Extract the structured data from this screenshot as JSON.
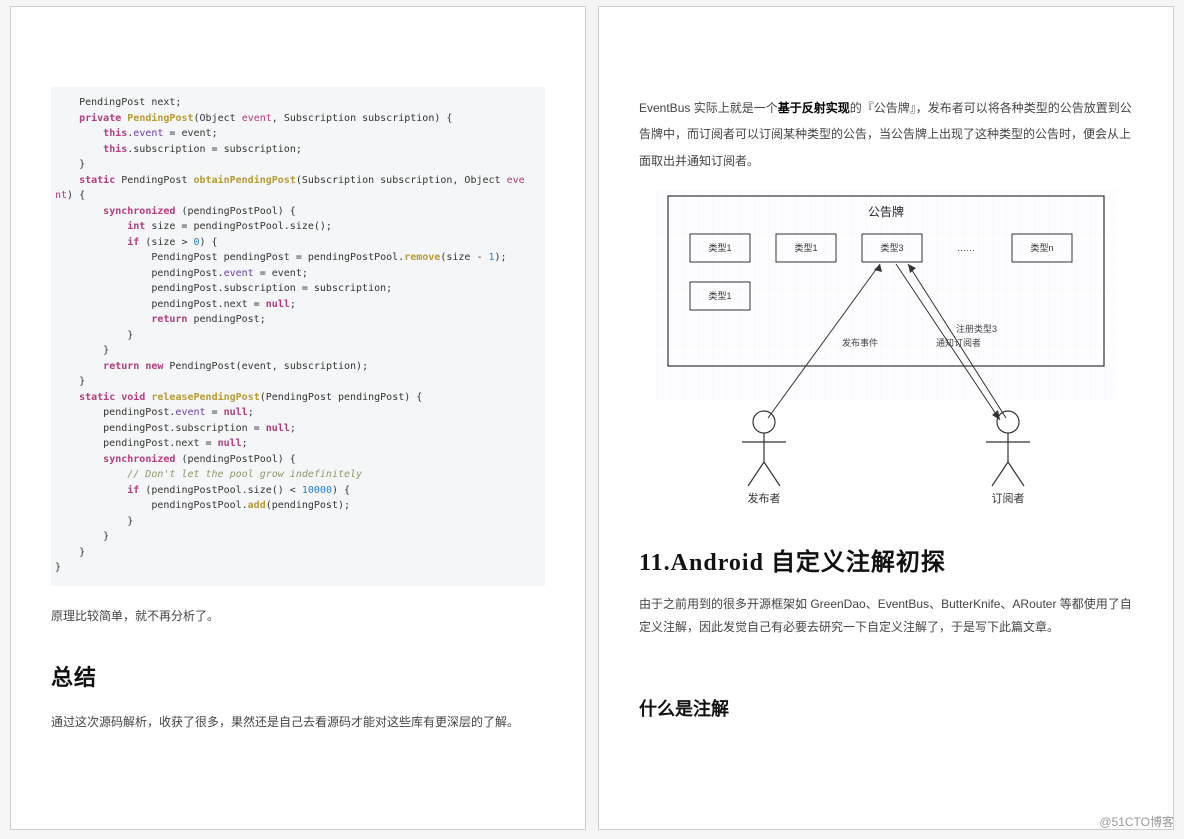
{
  "left": {
    "code_tokens": "CODE_RENDERED_DIRECTLY",
    "code_lines_plain": [
      "    PendingPost next;",
      "    private PendingPost(Object event, Subscription subscription) {",
      "        this.event = event;",
      "        this.subscription = subscription;",
      "    }",
      "    static PendingPost obtainPendingPost(Subscription subscription, Object eve",
      "nt) {",
      "        synchronized (pendingPostPool) {",
      "            int size = pendingPostPool.size();",
      "            if (size > 0) {",
      "                PendingPost pendingPost = pendingPostPool.remove(size - 1);",
      "                pendingPost.event = event;",
      "                pendingPost.subscription = subscription;",
      "                pendingPost.next = null;",
      "                return pendingPost;",
      "            }",
      "        }",
      "        return new PendingPost(event, subscription);",
      "    }",
      "    static void releasePendingPost(PendingPost pendingPost) {",
      "        pendingPost.event = null;",
      "        pendingPost.subscription = null;",
      "        pendingPost.next = null;",
      "        synchronized (pendingPostPool) {",
      "            // Don't let the pool grow indefinitely",
      "            if (pendingPostPool.size() < 10000) {",
      "                pendingPostPool.add(pendingPost);",
      "            }",
      "        }",
      "    }",
      "}"
    ],
    "after_code": "原理比较简单，就不再分析了。",
    "summary_title": "总结",
    "summary_body": "通过这次源码解析，收获了很多，果然还是自己去看源码才能对这些库有更深层的了解。"
  },
  "right": {
    "intro_pre": "EventBus  实际上就是一个",
    "intro_bold": "基于反射实现",
    "intro_post": "的『公告牌』，发布者可以将各种类型的公告放置到公告牌中，而订阅者可以订阅某种类型的公告，当公告牌上出现了这种类型的公告时，便会从上面取出并通知订阅者。",
    "diagram": {
      "board_title": "公告牌",
      "boxes": [
        "类型1",
        "类型1",
        "类型3",
        "类型n",
        "类型1"
      ],
      "ellipsis": "……",
      "labels": {
        "publish": "发布事件",
        "register": "注册类型3",
        "notify": "通知订阅者"
      },
      "actors": {
        "left": "发布者",
        "right": "订阅者"
      }
    },
    "h2": "11.Android  自定义注解初探",
    "para": "由于之前用到的很多开源框架如 GreenDao、EventBus、ButterKnife、ARouter 等都使用了自定义注解，因此发觉自己有必要去研究一下自定义注解了，于是写下此篇文章。",
    "h3": "什么是注解"
  },
  "watermark": "@51CTO博客"
}
